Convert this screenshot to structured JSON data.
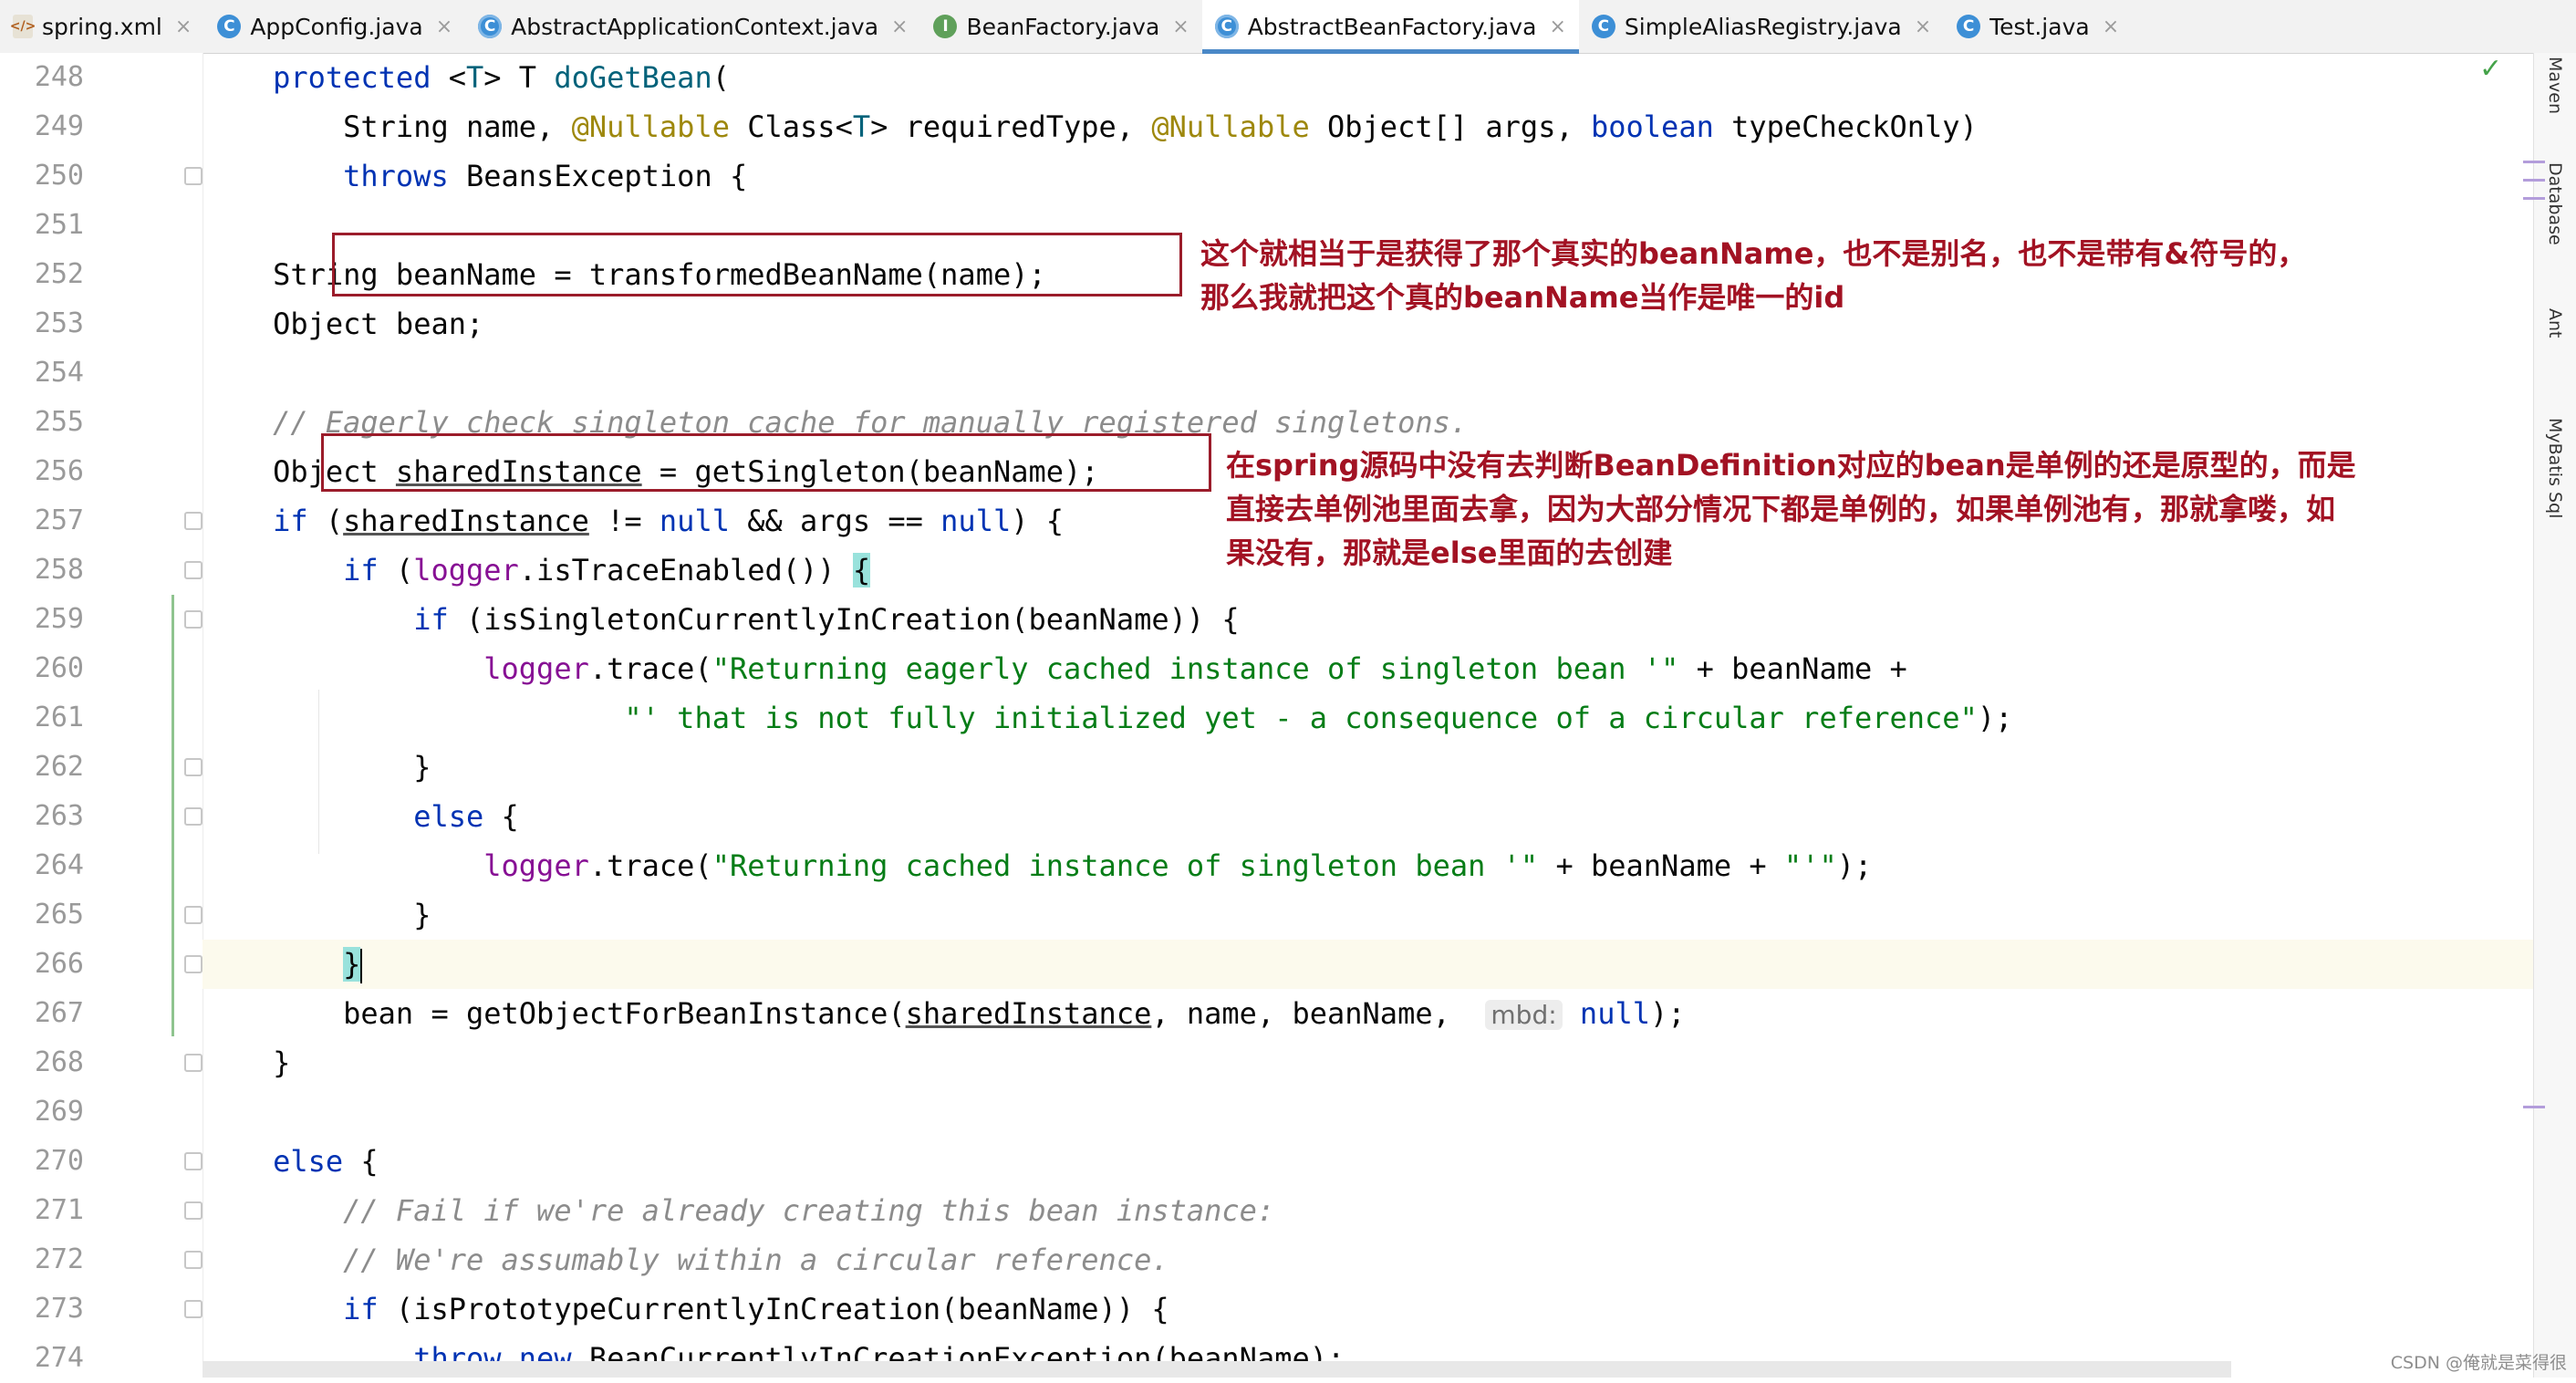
{
  "tabs": [
    {
      "label": "spring.xml",
      "icon": "xml-file-icon",
      "glyph": "</>",
      "kind": "xml"
    },
    {
      "label": "AppConfig.java",
      "icon": "java-class-icon",
      "glyph": "C",
      "kind": "c"
    },
    {
      "label": "AbstractApplicationContext.java",
      "icon": "abstract-class-icon",
      "glyph": "C",
      "kind": "ca"
    },
    {
      "label": "BeanFactory.java",
      "icon": "interface-icon",
      "glyph": "I",
      "kind": "i"
    },
    {
      "label": "AbstractBeanFactory.java",
      "icon": "abstract-class-icon",
      "glyph": "C",
      "kind": "ca",
      "active": true
    },
    {
      "label": "SimpleAliasRegistry.java",
      "icon": "java-class-icon",
      "glyph": "C",
      "kind": "c"
    },
    {
      "label": "Test.java",
      "icon": "java-class-icon",
      "glyph": "C",
      "kind": "c"
    }
  ],
  "tab_close_glyph": "×",
  "right_tools": [
    "Maven",
    "Database",
    "Ant",
    "MyBatis Sql"
  ],
  "line_numbers": [
    "248",
    "249",
    "250",
    "251",
    "252",
    "253",
    "254",
    "255",
    "256",
    "257",
    "258",
    "259",
    "260",
    "261",
    "262",
    "263",
    "264",
    "265",
    "266",
    "267",
    "268",
    "269",
    "270",
    "271",
    "272",
    "273",
    "274"
  ],
  "code": {
    "l248_indent": "    ",
    "l248_kw": "protected",
    "l248_a": " <",
    "l248_t": "T",
    "l248_b": "> T ",
    "l248_fn": "doGetBean",
    "l248_c": "(",
    "l249_a": "        String name, ",
    "l249_ann1": "@Nullable",
    "l249_b": " Class<",
    "l249_t": "T",
    "l249_c": "> requiredType, ",
    "l249_ann2": "@Nullable",
    "l249_d": " Object[] args, ",
    "l249_kw": "boolean",
    "l249_e": " typeCheckOnly)",
    "l250_indent": "        ",
    "l250_kw": "throws",
    "l250_a": " BeansException {",
    "l252": "    String beanName = transformedBeanName(name);",
    "l253": "    Object bean;",
    "l255": "    // Eagerly check singleton cache for manually registered singletons.",
    "l256_a": "    Object ",
    "l256_ul": "sharedInstance",
    "l256_b": " = getSingleton(beanName);",
    "l257_indent": "    ",
    "l257_kw": "if",
    "l257_a": " (",
    "l257_ul": "sharedInstance",
    "l257_b": " != ",
    "l257_null1": "null",
    "l257_c": " && args == ",
    "l257_null2": "null",
    "l257_d": ") {",
    "l258_indent": "        ",
    "l258_kw": "if",
    "l258_a": " (",
    "l258_fld": "logger",
    "l258_b": ".isTraceEnabled()) ",
    "l258_brace": "{",
    "l259_indent": "            ",
    "l259_kw": "if",
    "l259_a": " (isSingletonCurrentlyInCreation(beanName)) {",
    "l260_indent": "                ",
    "l260_fld": "logger",
    "l260_a": ".trace(",
    "l260_str": "\"Returning eagerly cached instance of singleton bean '\"",
    "l260_b": " + beanName +",
    "l261_indent": "                        ",
    "l261_str": "\"' that is not fully initialized yet - a consequence of a circular reference\"",
    "l261_a": ");",
    "l262": "            }",
    "l263_indent": "            ",
    "l263_kw": "else",
    "l263_a": " {",
    "l264_indent": "                ",
    "l264_fld": "logger",
    "l264_a": ".trace(",
    "l264_str1": "\"Returning cached instance of singleton bean '\"",
    "l264_b": " + beanName + ",
    "l264_str2": "\"'\"",
    "l264_c": ");",
    "l265": "            }",
    "l266_indent": "        ",
    "l266_brace": "}",
    "l267_a": "        bean = getObjectForBeanInstance(",
    "l267_ul": "sharedInstance",
    "l267_b": ", name, beanName,  ",
    "l267_hint": "mbd:",
    "l267_sp": " ",
    "l267_null": "null",
    "l267_c": ");",
    "l268": "    }",
    "l270_indent": "    ",
    "l270_kw": "else",
    "l270_a": " {",
    "l271": "        // Fail if we're already creating this bean instance:",
    "l272": "        // We're assumably within a circular reference.",
    "l273_indent": "        ",
    "l273_kw": "if",
    "l273_a": " (isPrototypeCurrentlyInCreation(beanName)) {",
    "l274_indent": "            ",
    "l274_kw1": "throw",
    "l274_sp": " ",
    "l274_kw2": "new",
    "l274_a": " BeanCurrentlyInCreationException(beanName);"
  },
  "annotations": {
    "note1_line1": "这个就相当于是获得了那个真实的beanName，也不是别名，也不是带有&符号的，",
    "note1_line2": "那么我就把这个真的beanName当作是唯一的id",
    "note2_line1": "在spring源码中没有去判断BeanDefinition对应的bean是单例的还是原型的，而是",
    "note2_line2": "直接去单例池里面去拿，因为大部分情况下都是单例的，如果单例池有，那就拿喽，如",
    "note2_line3": "果没有，那就是else里面的去创建",
    "color": "#a21223"
  },
  "watermark": "CSDN @俺就是菜得很"
}
